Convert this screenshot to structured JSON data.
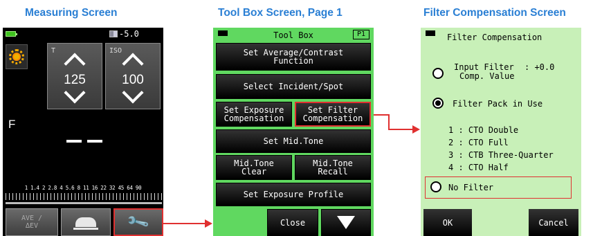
{
  "headings": {
    "measuring": "Measuring Screen",
    "toolbox": "Tool Box Screen, Page 1",
    "filter": "Filter Compensation Screen"
  },
  "measuring": {
    "ev_readout": "-5.0",
    "shutter_label": "T",
    "shutter_value": "125",
    "iso_label": "ISO",
    "iso_value": "100",
    "f_label": "F",
    "scale_text": "1 1.4 2 2.8 4 5.6 8 11 16 22 32 45 64 90",
    "ave_label_1": "AVE /",
    "ave_label_2": "∆EV",
    "icons": [
      "battery-icon",
      "flash-icon",
      "sun-icon",
      "chevron-up-icon",
      "chevron-down-icon",
      "scene-icon",
      "wrench-icon"
    ]
  },
  "toolbox": {
    "title": "Tool Box",
    "page": "P1",
    "buttons": {
      "avg_contrast_1": "Set Average/Contrast",
      "avg_contrast_2": "Function",
      "incident_spot": "Select Incident/Spot",
      "exp_comp_1": "Set Exposure",
      "exp_comp_2": "Compensation",
      "filter_comp_1": "Set Filter",
      "filter_comp_2": "Compensation",
      "mid_tone": "Set Mid.Tone",
      "mid_clear_1": "Mid.Tone",
      "mid_clear_2": "Clear",
      "mid_recall_1": "Mid.Tone",
      "mid_recall_2": "Recall",
      "exp_profile": "Set Exposure Profile",
      "close": "Close"
    }
  },
  "filter": {
    "title": "Filter Compensation",
    "input_filter_1": "Input Filter",
    "input_filter_2": "Comp. Value",
    "input_filter_value": ": +0.0",
    "filter_pack": "Filter Pack in Use",
    "filters": [
      "1 : CTO Double",
      "2 : CTO Full",
      "3 : CTB Three-Quarter",
      "4 : CTO Half"
    ],
    "no_filter": "No Filter",
    "ok": "OK",
    "cancel": "Cancel",
    "selected_option": "Filter Pack in Use"
  },
  "colors": {
    "heading": "#2a7fd4",
    "highlight": "#e03030",
    "toolbox_bg": "#60d860",
    "filter_bg": "#c8f0b8"
  }
}
